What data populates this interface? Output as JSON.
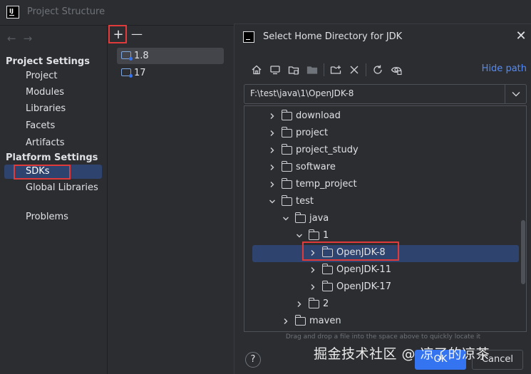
{
  "window": {
    "title": "Project Structure"
  },
  "nav": {
    "back_arrow": "←",
    "forward_arrow": "→",
    "project_heading": "Project Settings",
    "project_items": [
      "Project",
      "Modules",
      "Libraries",
      "Facets",
      "Artifacts"
    ],
    "platform_heading": "Platform Settings",
    "platform_items": [
      "SDKs",
      "Global Libraries"
    ],
    "selected": "SDKs",
    "other_items": [
      "Problems"
    ]
  },
  "sdk_list": {
    "add_label": "+",
    "remove_label": "—",
    "items": [
      "1.8",
      "17"
    ],
    "selected": "1.8"
  },
  "dialog": {
    "title": "Select Home Directory for JDK",
    "close_label": "✕",
    "toolbar_icons": [
      "home-icon",
      "desktop-icon",
      "project-folder-icon",
      "module-folder-icon",
      "new-folder-icon",
      "delete-icon",
      "refresh-icon",
      "show-hidden-icon"
    ],
    "hide_path_label": "Hide path",
    "path_value": "F:\\test\\java\\1\\OpenJDK-8",
    "tree": [
      {
        "label": "download",
        "depth": 0,
        "expanded": false
      },
      {
        "label": "project",
        "depth": 0,
        "expanded": false
      },
      {
        "label": "project_study",
        "depth": 0,
        "expanded": false
      },
      {
        "label": "software",
        "depth": 0,
        "expanded": false
      },
      {
        "label": "temp_project",
        "depth": 0,
        "expanded": false
      },
      {
        "label": "test",
        "depth": 0,
        "expanded": true
      },
      {
        "label": "java",
        "depth": 1,
        "expanded": true
      },
      {
        "label": "1",
        "depth": 2,
        "expanded": true
      },
      {
        "label": "OpenJDK-8",
        "depth": 3,
        "expanded": false,
        "selected": true
      },
      {
        "label": "OpenJDK-11",
        "depth": 3,
        "expanded": false
      },
      {
        "label": "OpenJDK-17",
        "depth": 3,
        "expanded": false
      },
      {
        "label": "2",
        "depth": 2,
        "expanded": false
      },
      {
        "label": "maven",
        "depth": 1,
        "expanded": false
      }
    ],
    "hint": "Drag and drop a file into the space above to quickly locate it",
    "help_label": "?",
    "ok_label": "OK",
    "cancel_label": "Cancel"
  },
  "watermark": "掘金技术社区 @ 凉了的凉茶",
  "colors": {
    "background": "#2b2d30",
    "selection": "#2e436e",
    "accent": "#3574f0",
    "link": "#548af7",
    "highlight_box": "#e03a3a"
  }
}
